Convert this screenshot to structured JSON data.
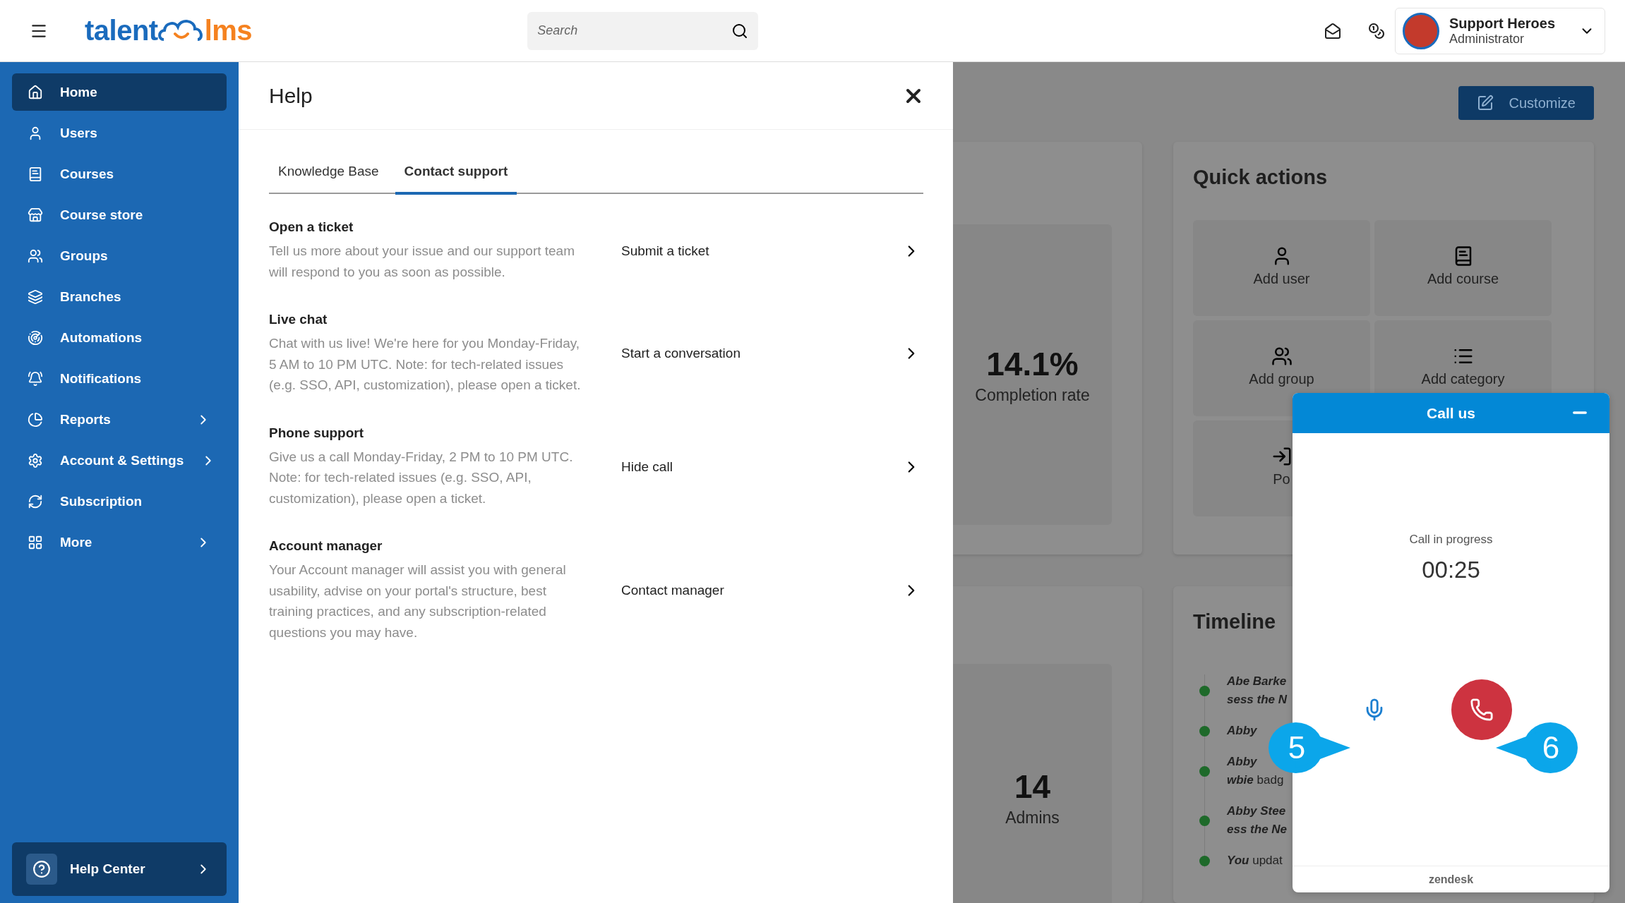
{
  "topbar": {
    "logo": {
      "left": "talent",
      "right": "lms"
    },
    "search": {
      "placeholder": "Search"
    },
    "user": {
      "name": "Support Heroes",
      "role": "Administrator"
    }
  },
  "sidebar": {
    "items": [
      {
        "label": "Home",
        "selected": true,
        "submenu": false
      },
      {
        "label": "Users",
        "selected": false,
        "submenu": false
      },
      {
        "label": "Courses",
        "selected": false,
        "submenu": false
      },
      {
        "label": "Course store",
        "selected": false,
        "submenu": false
      },
      {
        "label": "Groups",
        "selected": false,
        "submenu": false
      },
      {
        "label": "Branches",
        "selected": false,
        "submenu": false
      },
      {
        "label": "Automations",
        "selected": false,
        "submenu": false
      },
      {
        "label": "Notifications",
        "selected": false,
        "submenu": false
      },
      {
        "label": "Reports",
        "selected": false,
        "submenu": true
      },
      {
        "label": "Account & Settings",
        "selected": false,
        "submenu": true
      },
      {
        "label": "Subscription",
        "selected": false,
        "submenu": false
      },
      {
        "label": "More",
        "selected": false,
        "submenu": true
      }
    ],
    "help_center": {
      "label": "Help Center"
    }
  },
  "help": {
    "title": "Help",
    "tabs": [
      {
        "label": "Knowledge Base",
        "selected": false
      },
      {
        "label": "Contact support",
        "selected": true
      }
    ],
    "sections": [
      {
        "title": "Open a ticket",
        "description": "Tell us more about your issue and our support team will respond to you as soon as possible.",
        "action": "Submit a ticket"
      },
      {
        "title": "Live chat",
        "description": "Chat with us live! We're here for you Monday-Friday, 5 AM to 10 PM UTC. Note: for tech-related issues (e.g. SSO, API, customization), please open a ticket.",
        "action": "Start a conversation"
      },
      {
        "title": "Phone support",
        "description": "Give us a call Monday-Friday, 2 PM to 10 PM UTC. Note: for tech-related issues (e.g. SSO, API, customization), please open a ticket.",
        "action": "Hide call"
      },
      {
        "title": "Account manager",
        "description": "Your Account manager will assist you with general usability, advise on your portal's structure, best training practices, and any subscription-related questions you may have.",
        "action": "Contact manager"
      }
    ]
  },
  "dashboard": {
    "customize": "Customize",
    "completion": {
      "value": "14.1%",
      "label": "Completion rate"
    },
    "quick_actions": {
      "title": "Quick actions",
      "tiles": [
        {
          "label": "Add user"
        },
        {
          "label": "Add course"
        },
        {
          "label": "Add group"
        },
        {
          "label": "Add category"
        },
        {
          "label": "Po"
        }
      ]
    },
    "admins": {
      "value": "14",
      "label": "Admins"
    },
    "timeline": {
      "title": "Timeline",
      "entries": [
        {
          "lines": [
            "Abe Barke",
            "sess the N"
          ]
        },
        {
          "lines": [
            "Abby"
          ]
        },
        {
          "lines": [
            "Abby",
            "wbie *badg*"
          ]
        },
        {
          "lines": [
            "Abby Stee",
            "ess the Ne"
          ]
        },
        {
          "lines": [
            "You *updat*"
          ]
        }
      ]
    }
  },
  "call_widget": {
    "title": "Call us",
    "status": "Call in progress",
    "timer": "00:25",
    "footer": "zendesk"
  },
  "callouts": [
    {
      "label": "5",
      "kind": "right"
    },
    {
      "label": "6",
      "kind": "left"
    }
  ]
}
